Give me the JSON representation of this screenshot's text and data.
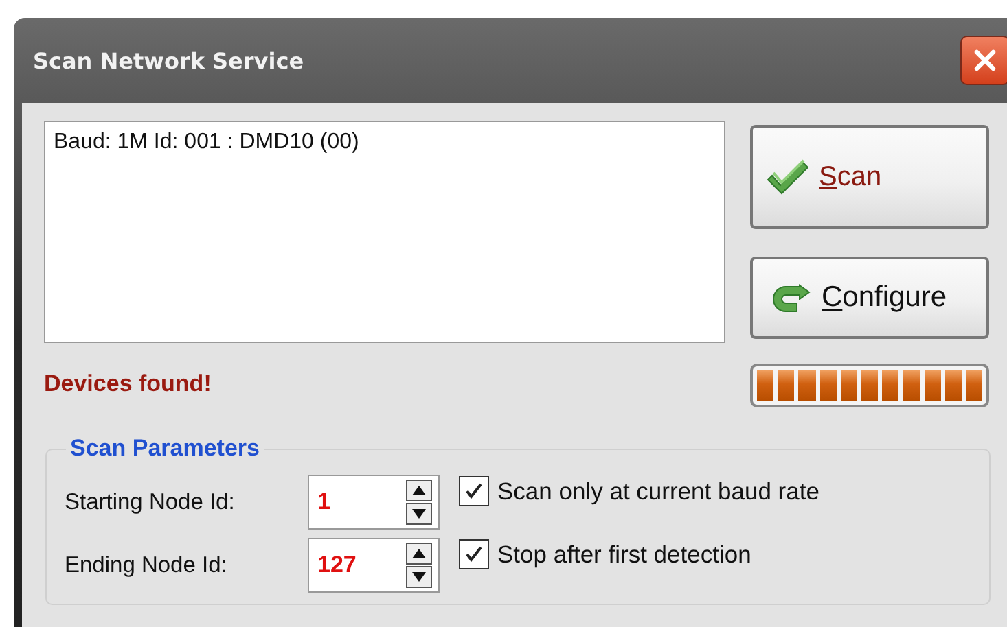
{
  "window": {
    "title": "Scan Network Service"
  },
  "results": {
    "items": [
      "Baud: 1M  Id: 001 : DMD10 (00)"
    ]
  },
  "buttons": [
    {
      "label": "Scan",
      "kind": "scan",
      "access_key": true
    },
    {
      "label": "Configure",
      "kind": "configure",
      "access_key": true
    }
  ],
  "status": "Devices found!",
  "progress": {
    "level": 1
  },
  "scan_parameters": {
    "title": "Scan Parameters",
    "fields": [
      {
        "label": "Starting Node Id:",
        "value": "1"
      },
      {
        "label": "Ending Node Id:",
        "value": "127"
      }
    ],
    "options": [
      {
        "label": "Scan only at current baud rate",
        "checked": true
      },
      {
        "label": "Stop after first detection",
        "checked": true
      }
    ]
  }
}
